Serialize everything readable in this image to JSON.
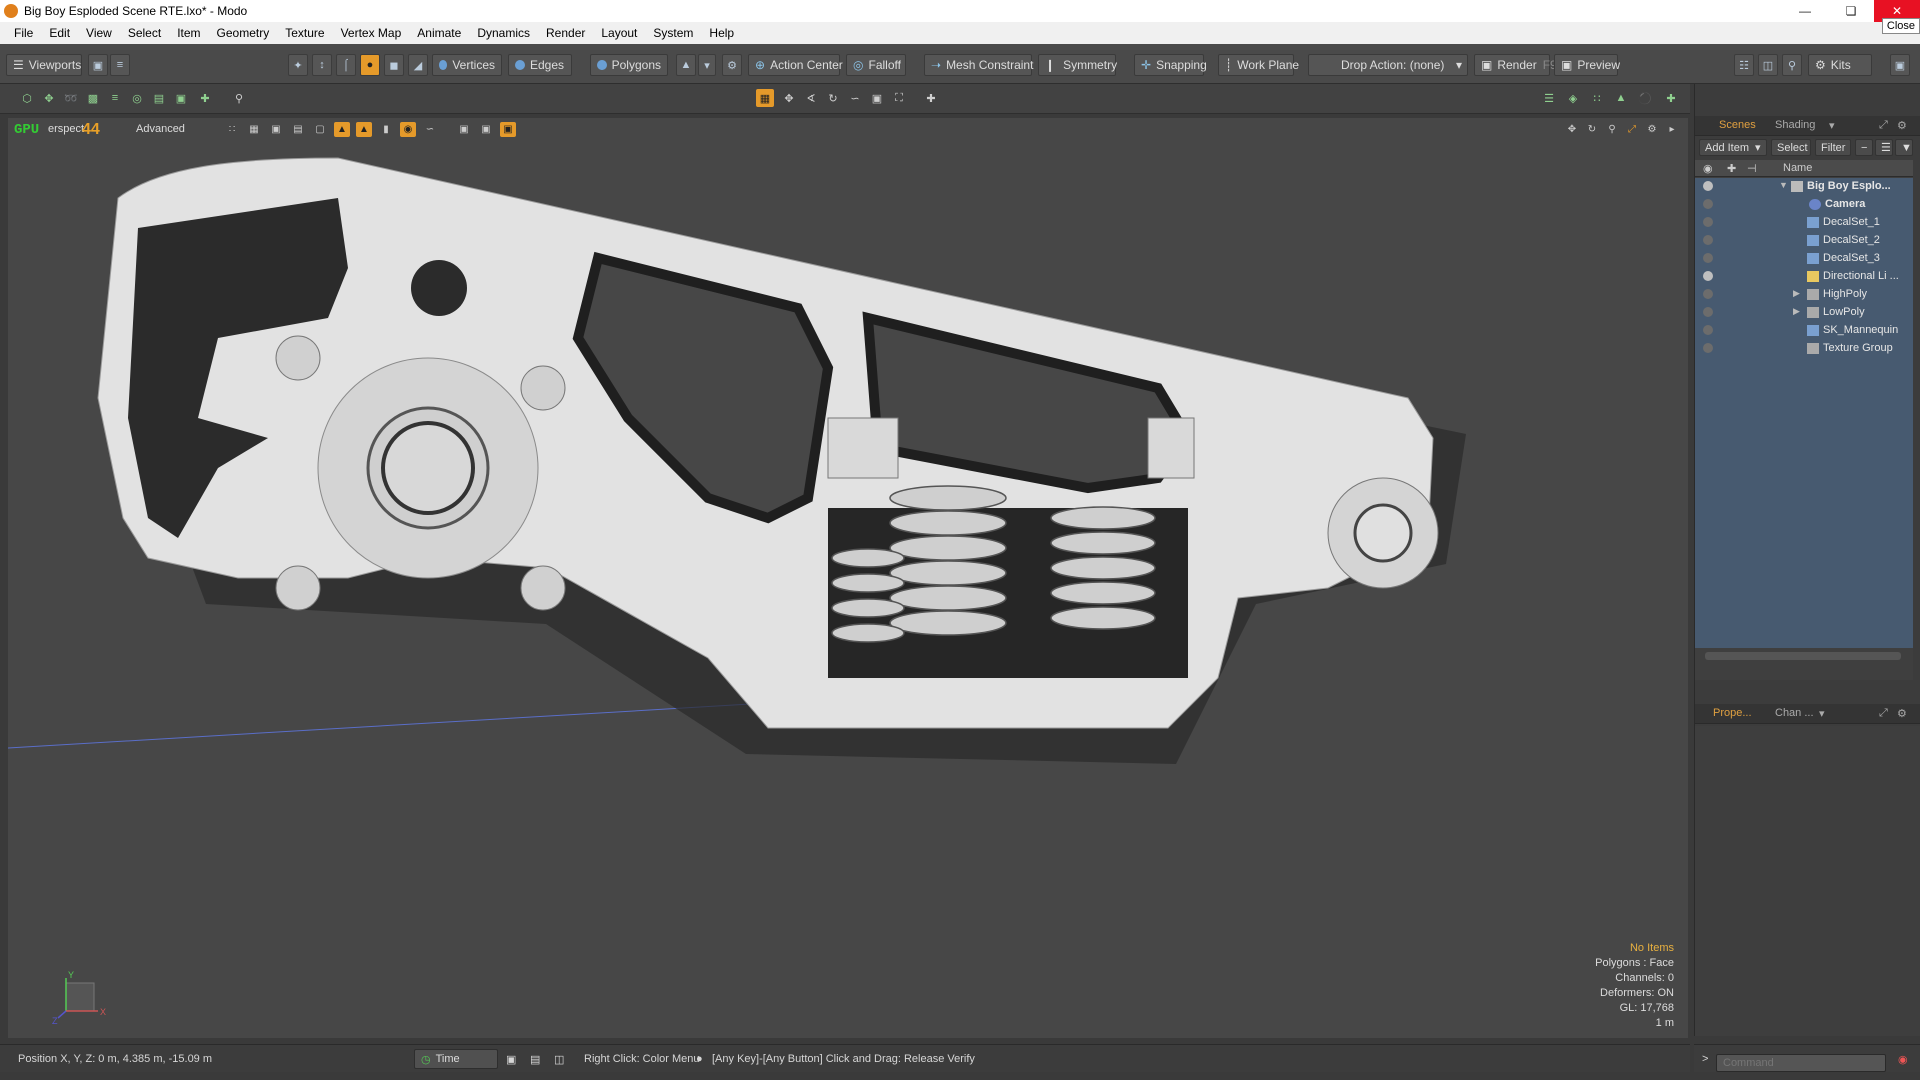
{
  "window": {
    "title": "Big Boy Esploded Scene RTE.lxo* - Modo",
    "close_tooltip": "Close"
  },
  "menu": [
    "File",
    "Edit",
    "View",
    "Select",
    "Item",
    "Geometry",
    "Texture",
    "Vertex Map",
    "Animate",
    "Dynamics",
    "Render",
    "Layout",
    "System",
    "Help"
  ],
  "toolbar": {
    "viewports": "Viewports",
    "vertices": "Vertices",
    "edges": "Edges",
    "polygons": "Polygons",
    "action_center": "Action Center",
    "falloff": "Falloff",
    "mesh_constraint": "Mesh Constraint",
    "symmetry": "Symmetry",
    "snapping": "Snapping",
    "work_plane": "Work Plane",
    "drop_action": "Drop Action: (none)",
    "render": "Render",
    "render_shortcut": "F9",
    "preview": "Preview",
    "kits": "Kits"
  },
  "viewport": {
    "gpu_label": "GPU",
    "gpu_count": "44",
    "view_name": "erspect",
    "shading_mode": "Advanced",
    "info": {
      "selection": "No Items",
      "polygons": "Polygons : Face",
      "channels": "Channels: 0",
      "deformers": "Deformers: ON",
      "gl": "GL: 17,768",
      "scale": "1 m"
    },
    "axes": {
      "y": "Y",
      "x": "X",
      "z": "Z"
    }
  },
  "scene_panel": {
    "tabs": [
      "Scenes",
      "Shading"
    ],
    "add_item": "Add Item",
    "select": "Select",
    "filter": "Filter",
    "name_header": "Name",
    "items": [
      {
        "label": "Big Boy Esplo...",
        "type": "root",
        "visible": true
      },
      {
        "label": "Camera",
        "type": "camera",
        "visible": false
      },
      {
        "label": "DecalSet_1",
        "type": "mesh",
        "visible": false
      },
      {
        "label": "DecalSet_2",
        "type": "mesh",
        "visible": false
      },
      {
        "label": "DecalSet_3",
        "type": "mesh",
        "visible": false
      },
      {
        "label": "Directional Li ...",
        "type": "light",
        "visible": true
      },
      {
        "label": "HighPoly",
        "type": "group",
        "visible": false
      },
      {
        "label": "LowPoly",
        "type": "group",
        "visible": false
      },
      {
        "label": "SK_Mannequin",
        "type": "mesh",
        "visible": false
      },
      {
        "label": "Texture Group",
        "type": "group",
        "visible": false
      }
    ]
  },
  "properties_panel": {
    "tabs": [
      "Prope...",
      "Chan ..."
    ]
  },
  "status": {
    "position": "Position X, Y, Z:  0 m, 4.385 m, -15.09 m",
    "time": "Time",
    "hint": "Right Click: Color Menu",
    "hint2": "[Any Key]-[Any Button] Click and Drag: Release Verify",
    "command_placeholder": "Command"
  }
}
